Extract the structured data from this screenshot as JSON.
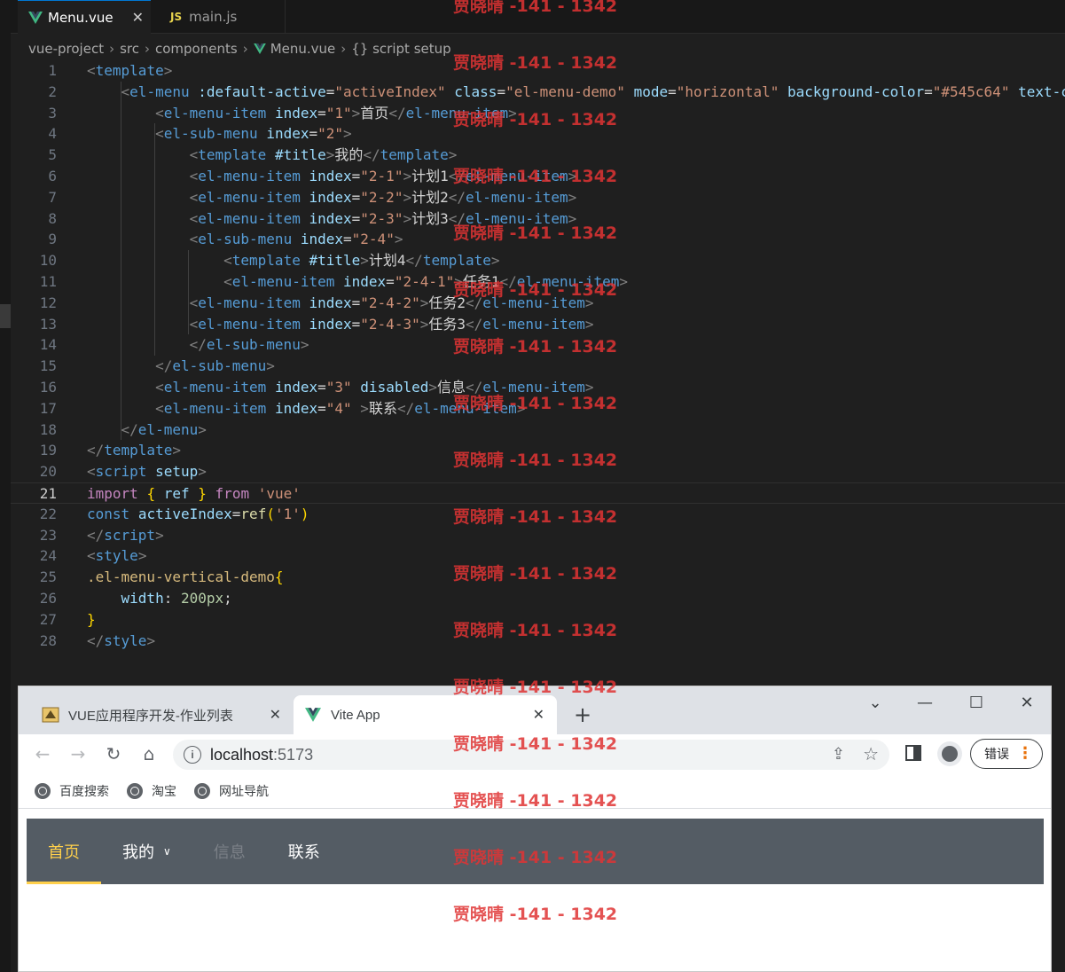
{
  "editor": {
    "tabs": [
      {
        "label": "Menu.vue",
        "active": true,
        "icon": "vue-icon"
      },
      {
        "label": "main.js",
        "active": false,
        "icon": "js-icon"
      }
    ],
    "breadcrumb": [
      "vue-project",
      "src",
      "components",
      "Menu.vue",
      "{} script setup"
    ],
    "current_line": 21,
    "lines": [
      {
        "n": "1",
        "tokens": [
          [
            "brk",
            "<"
          ],
          [
            "tag",
            "template"
          ],
          [
            "brk",
            ">"
          ]
        ]
      },
      {
        "n": "2",
        "tokens": [
          [
            "txt",
            "    "
          ],
          [
            "brk",
            "<"
          ],
          [
            "tag",
            "el-menu"
          ],
          [
            "txt",
            " "
          ],
          [
            "attr",
            ":default-active"
          ],
          [
            "txt",
            "="
          ],
          [
            "str",
            "\"activeIndex\""
          ],
          [
            "txt",
            " "
          ],
          [
            "attr",
            "class"
          ],
          [
            "txt",
            "="
          ],
          [
            "str",
            "\"el-menu-demo\""
          ],
          [
            "txt",
            " "
          ],
          [
            "attr",
            "mode"
          ],
          [
            "txt",
            "="
          ],
          [
            "str",
            "\"horizontal\""
          ],
          [
            "txt",
            " "
          ],
          [
            "attr",
            "background-color"
          ],
          [
            "txt",
            "="
          ],
          [
            "str",
            "\"#545c64\""
          ],
          [
            "txt",
            " "
          ],
          [
            "attr",
            "text-c"
          ]
        ]
      },
      {
        "n": "3",
        "tokens": [
          [
            "txt",
            "        "
          ],
          [
            "brk",
            "<"
          ],
          [
            "tag",
            "el-menu-item"
          ],
          [
            "txt",
            " "
          ],
          [
            "attr",
            "index"
          ],
          [
            "txt",
            "="
          ],
          [
            "str",
            "\"1\""
          ],
          [
            "brk",
            ">"
          ],
          [
            "txt",
            "首页"
          ],
          [
            "brk",
            "</"
          ],
          [
            "tag",
            "el-menu-item"
          ],
          [
            "brk",
            ">"
          ]
        ]
      },
      {
        "n": "4",
        "tokens": [
          [
            "txt",
            "        "
          ],
          [
            "brk",
            "<"
          ],
          [
            "tag",
            "el-sub-menu"
          ],
          [
            "txt",
            " "
          ],
          [
            "attr",
            "index"
          ],
          [
            "txt",
            "="
          ],
          [
            "str",
            "\"2\""
          ],
          [
            "brk",
            ">"
          ]
        ]
      },
      {
        "n": "5",
        "tokens": [
          [
            "txt",
            "            "
          ],
          [
            "brk",
            "<"
          ],
          [
            "tag",
            "template"
          ],
          [
            "txt",
            " "
          ],
          [
            "attr",
            "#title"
          ],
          [
            "brk",
            ">"
          ],
          [
            "txt",
            "我的"
          ],
          [
            "brk",
            "</"
          ],
          [
            "tag",
            "template"
          ],
          [
            "brk",
            ">"
          ]
        ]
      },
      {
        "n": "6",
        "tokens": [
          [
            "txt",
            "            "
          ],
          [
            "brk",
            "<"
          ],
          [
            "tag",
            "el-menu-item"
          ],
          [
            "txt",
            " "
          ],
          [
            "attr",
            "index"
          ],
          [
            "txt",
            "="
          ],
          [
            "str",
            "\"2-1\""
          ],
          [
            "brk",
            ">"
          ],
          [
            "txt",
            "计划1"
          ],
          [
            "brk",
            "</"
          ],
          [
            "tag",
            "el-menu-item"
          ],
          [
            "brk",
            ">"
          ]
        ]
      },
      {
        "n": "7",
        "tokens": [
          [
            "txt",
            "            "
          ],
          [
            "brk",
            "<"
          ],
          [
            "tag",
            "el-menu-item"
          ],
          [
            "txt",
            " "
          ],
          [
            "attr",
            "index"
          ],
          [
            "txt",
            "="
          ],
          [
            "str",
            "\"2-2\""
          ],
          [
            "brk",
            ">"
          ],
          [
            "txt",
            "计划2"
          ],
          [
            "brk",
            "</"
          ],
          [
            "tag",
            "el-menu-item"
          ],
          [
            "brk",
            ">"
          ]
        ]
      },
      {
        "n": "8",
        "tokens": [
          [
            "txt",
            "            "
          ],
          [
            "brk",
            "<"
          ],
          [
            "tag",
            "el-menu-item"
          ],
          [
            "txt",
            " "
          ],
          [
            "attr",
            "index"
          ],
          [
            "txt",
            "="
          ],
          [
            "str",
            "\"2-3\""
          ],
          [
            "brk",
            ">"
          ],
          [
            "txt",
            "计划3"
          ],
          [
            "brk",
            "</"
          ],
          [
            "tag",
            "el-menu-item"
          ],
          [
            "brk",
            ">"
          ]
        ]
      },
      {
        "n": "9",
        "tokens": [
          [
            "txt",
            "            "
          ],
          [
            "brk",
            "<"
          ],
          [
            "tag",
            "el-sub-menu"
          ],
          [
            "txt",
            " "
          ],
          [
            "attr",
            "index"
          ],
          [
            "txt",
            "="
          ],
          [
            "str",
            "\"2-4\""
          ],
          [
            "brk",
            ">"
          ]
        ]
      },
      {
        "n": "10",
        "tokens": [
          [
            "txt",
            "                "
          ],
          [
            "brk",
            "<"
          ],
          [
            "tag",
            "template"
          ],
          [
            "txt",
            " "
          ],
          [
            "attr",
            "#title"
          ],
          [
            "brk",
            ">"
          ],
          [
            "txt",
            "计划4"
          ],
          [
            "brk",
            "</"
          ],
          [
            "tag",
            "template"
          ],
          [
            "brk",
            ">"
          ]
        ]
      },
      {
        "n": "11",
        "tokens": [
          [
            "txt",
            "                "
          ],
          [
            "brk",
            "<"
          ],
          [
            "tag",
            "el-menu-item"
          ],
          [
            "txt",
            " "
          ],
          [
            "attr",
            "index"
          ],
          [
            "txt",
            "="
          ],
          [
            "str",
            "\"2-4-1\""
          ],
          [
            "brk",
            ">"
          ],
          [
            "txt",
            "任务1"
          ],
          [
            "brk",
            "</"
          ],
          [
            "tag",
            "el-menu-item"
          ],
          [
            "brk",
            ">"
          ]
        ]
      },
      {
        "n": "12",
        "tokens": [
          [
            "txt",
            "            "
          ],
          [
            "brk",
            "<"
          ],
          [
            "tag",
            "el-menu-item"
          ],
          [
            "txt",
            " "
          ],
          [
            "attr",
            "index"
          ],
          [
            "txt",
            "="
          ],
          [
            "str",
            "\"2-4-2\""
          ],
          [
            "brk",
            ">"
          ],
          [
            "txt",
            "任务2"
          ],
          [
            "brk",
            "</"
          ],
          [
            "tag",
            "el-menu-item"
          ],
          [
            "brk",
            ">"
          ]
        ]
      },
      {
        "n": "13",
        "tokens": [
          [
            "txt",
            "            "
          ],
          [
            "brk",
            "<"
          ],
          [
            "tag",
            "el-menu-item"
          ],
          [
            "txt",
            " "
          ],
          [
            "attr",
            "index"
          ],
          [
            "txt",
            "="
          ],
          [
            "str",
            "\"2-4-3\""
          ],
          [
            "brk",
            ">"
          ],
          [
            "txt",
            "任务3"
          ],
          [
            "brk",
            "</"
          ],
          [
            "tag",
            "el-menu-item"
          ],
          [
            "brk",
            ">"
          ]
        ]
      },
      {
        "n": "14",
        "tokens": [
          [
            "txt",
            "            "
          ],
          [
            "brk",
            "</"
          ],
          [
            "tag",
            "el-sub-menu"
          ],
          [
            "brk",
            ">"
          ]
        ]
      },
      {
        "n": "15",
        "tokens": [
          [
            "txt",
            "        "
          ],
          [
            "brk",
            "</"
          ],
          [
            "tag",
            "el-sub-menu"
          ],
          [
            "brk",
            ">"
          ]
        ]
      },
      {
        "n": "16",
        "tokens": [
          [
            "txt",
            "        "
          ],
          [
            "brk",
            "<"
          ],
          [
            "tag",
            "el-menu-item"
          ],
          [
            "txt",
            " "
          ],
          [
            "attr",
            "index"
          ],
          [
            "txt",
            "="
          ],
          [
            "str",
            "\"3\""
          ],
          [
            "txt",
            " "
          ],
          [
            "attr",
            "disabled"
          ],
          [
            "brk",
            ">"
          ],
          [
            "txt",
            "信息"
          ],
          [
            "brk",
            "</"
          ],
          [
            "tag",
            "el-menu-item"
          ],
          [
            "brk",
            ">"
          ]
        ]
      },
      {
        "n": "17",
        "tokens": [
          [
            "txt",
            "        "
          ],
          [
            "brk",
            "<"
          ],
          [
            "tag",
            "el-menu-item"
          ],
          [
            "txt",
            " "
          ],
          [
            "attr",
            "index"
          ],
          [
            "txt",
            "="
          ],
          [
            "str",
            "\"4\""
          ],
          [
            "txt",
            " "
          ],
          [
            "brk",
            ">"
          ],
          [
            "txt",
            "联系"
          ],
          [
            "brk",
            "</"
          ],
          [
            "tag",
            "el-menu-item"
          ],
          [
            "brk",
            ">"
          ]
        ]
      },
      {
        "n": "18",
        "tokens": [
          [
            "txt",
            "    "
          ],
          [
            "brk",
            "</"
          ],
          [
            "tag",
            "el-menu"
          ],
          [
            "brk",
            ">"
          ]
        ]
      },
      {
        "n": "19",
        "tokens": [
          [
            "brk",
            "</"
          ],
          [
            "tag",
            "template"
          ],
          [
            "brk",
            ">"
          ]
        ]
      },
      {
        "n": "20",
        "tokens": [
          [
            "brk",
            "<"
          ],
          [
            "tag",
            "script"
          ],
          [
            "txt",
            " "
          ],
          [
            "attr",
            "setup"
          ],
          [
            "brk",
            ">"
          ]
        ]
      },
      {
        "n": "21",
        "tokens": [
          [
            "kw",
            "import"
          ],
          [
            "txt",
            " "
          ],
          [
            "pun",
            "{"
          ],
          [
            "txt",
            " "
          ],
          [
            "var",
            "ref"
          ],
          [
            "txt",
            " "
          ],
          [
            "pun",
            "}"
          ],
          [
            "txt",
            " "
          ],
          [
            "kw",
            "from"
          ],
          [
            "txt",
            " "
          ],
          [
            "str",
            "'vue'"
          ]
        ]
      },
      {
        "n": "22",
        "tokens": [
          [
            "kw2",
            "const"
          ],
          [
            "txt",
            " "
          ],
          [
            "var",
            "activeIndex"
          ],
          [
            "op",
            "="
          ],
          [
            "fn",
            "ref"
          ],
          [
            "pun",
            "("
          ],
          [
            "str",
            "'1'"
          ],
          [
            "pun",
            ")"
          ]
        ]
      },
      {
        "n": "23",
        "tokens": [
          [
            "brk",
            "</"
          ],
          [
            "tag",
            "script"
          ],
          [
            "brk",
            ">"
          ]
        ]
      },
      {
        "n": "24",
        "tokens": [
          [
            "brk",
            "<"
          ],
          [
            "tag",
            "style"
          ],
          [
            "brk",
            ">"
          ]
        ]
      },
      {
        "n": "25",
        "tokens": [
          [
            "cls",
            ".el-menu-vertical-demo"
          ],
          [
            "pun",
            "{"
          ]
        ]
      },
      {
        "n": "26",
        "tokens": [
          [
            "txt",
            "    "
          ],
          [
            "attr",
            "width"
          ],
          [
            "txt",
            ": "
          ],
          [
            "num",
            "200px"
          ],
          [
            "txt",
            ";"
          ]
        ]
      },
      {
        "n": "27",
        "tokens": [
          [
            "pun",
            "}"
          ]
        ]
      },
      {
        "n": "28",
        "tokens": [
          [
            "brk",
            "</"
          ],
          [
            "tag",
            "style"
          ],
          [
            "brk",
            ">"
          ]
        ]
      }
    ]
  },
  "watermark": "贾晓晴 -141 - 1342",
  "browser": {
    "tabs": [
      {
        "label": "VUE应用程序开发-作业列表",
        "active": false
      },
      {
        "label": "Vite App",
        "active": true
      }
    ],
    "url_host": "localhost",
    "url_port": ":5173",
    "error_label": "错误",
    "bookmarks": [
      "百度搜索",
      "淘宝",
      "网址导航"
    ],
    "menu": {
      "background": "#545c64",
      "active_color": "#ffd04b",
      "items": [
        {
          "label": "首页",
          "state": "active"
        },
        {
          "label": "我的",
          "state": "submenu"
        },
        {
          "label": "信息",
          "state": "disabled"
        },
        {
          "label": "联系",
          "state": "normal"
        }
      ]
    }
  }
}
